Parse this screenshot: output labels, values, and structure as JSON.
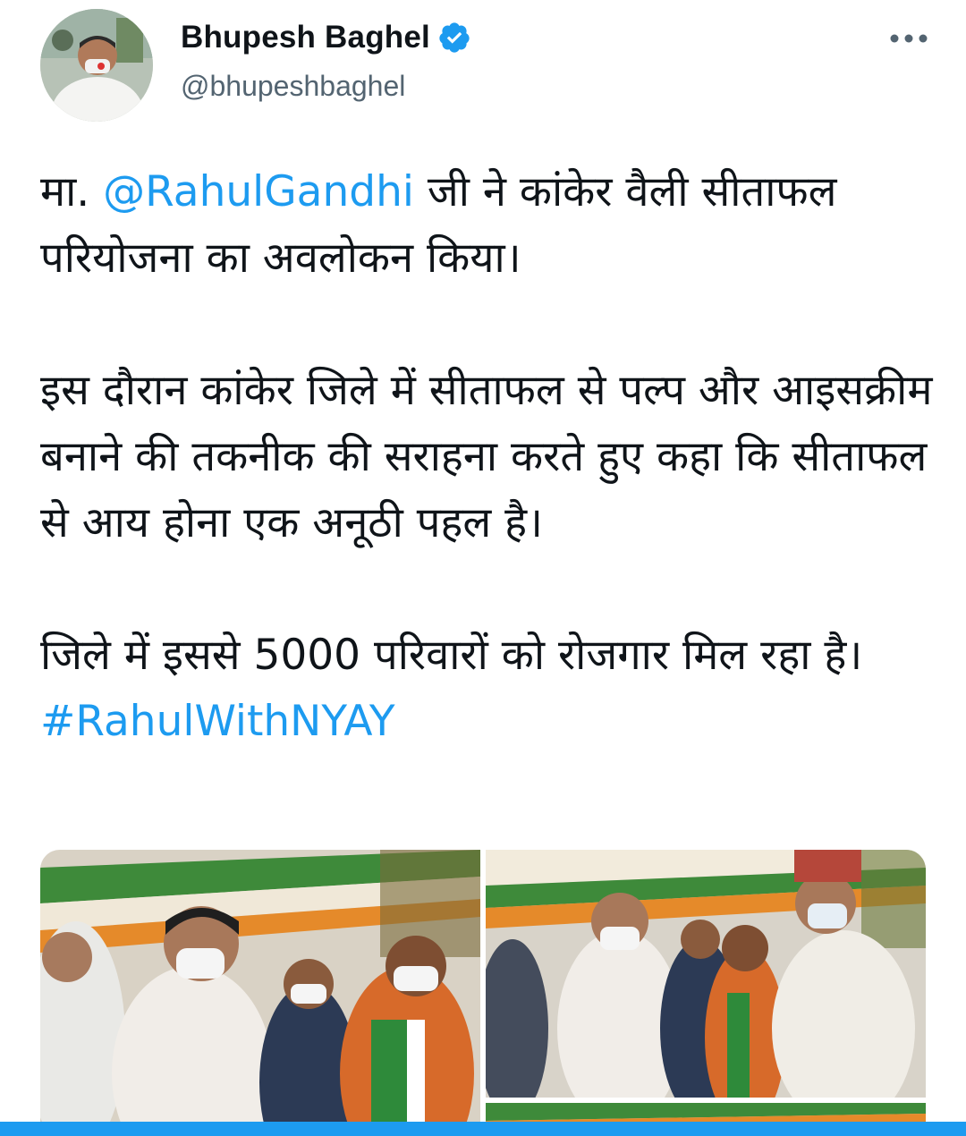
{
  "author": {
    "name": "Bhupesh Baghel",
    "handle": "@bhupeshbaghel",
    "verified": true
  },
  "tweet": {
    "paragraphs": [
      [
        {
          "text": "मा. ",
          "link": false
        },
        {
          "text": "@RahulGandhi",
          "link": true
        },
        {
          "text": " जी ने कांकेर वैली सीताफल परियोजना का अवलोकन किया।",
          "link": false
        }
      ],
      [
        {
          "text": "इस दौरान कांकेर जिले में सीताफल से पल्प और आइसक्रीम बनाने की तकनीक की सराहना करते हुए कहा कि सीताफल से आय होना एक अनूठी पहल है।",
          "link": false
        }
      ],
      [
        {
          "text": "जिले में इससे  5000 परिवारों को रोजगार मिल रहा है। ",
          "link": false
        },
        {
          "text": "#RahulWithNYAY",
          "link": true
        }
      ]
    ]
  },
  "icons": {
    "verified": "verified-badge-icon",
    "more": "more-horizontal-icon"
  },
  "colors": {
    "accent": "#1d9bf0",
    "text": "#0f1419",
    "secondary": "#536471"
  }
}
